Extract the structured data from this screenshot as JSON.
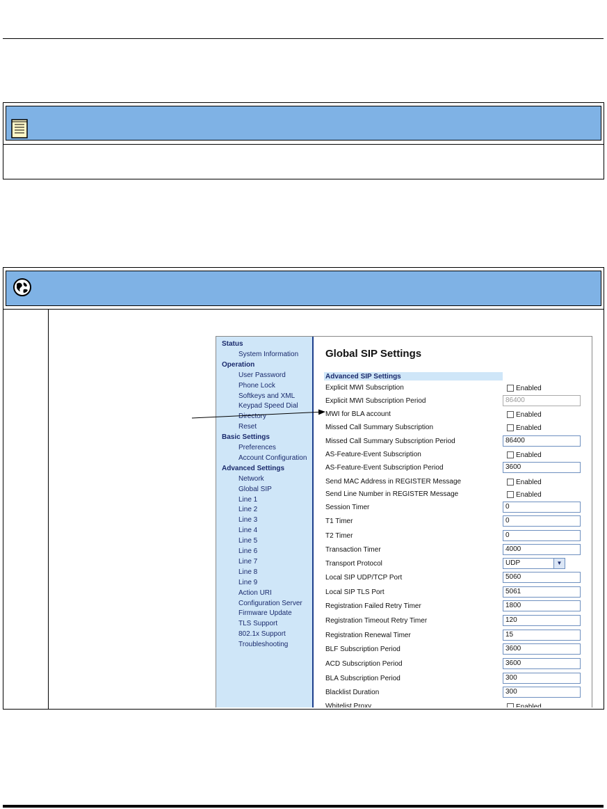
{
  "sidebar": {
    "items": [
      {
        "label": "Status",
        "kind": "head"
      },
      {
        "label": "System Information",
        "kind": "sub"
      },
      {
        "label": "Operation",
        "kind": "head"
      },
      {
        "label": "User Password",
        "kind": "sub"
      },
      {
        "label": "Phone Lock",
        "kind": "sub"
      },
      {
        "label": "Softkeys and XML",
        "kind": "sub"
      },
      {
        "label": "Keypad Speed Dial",
        "kind": "sub"
      },
      {
        "label": "Directory",
        "kind": "sub"
      },
      {
        "label": "Reset",
        "kind": "sub"
      },
      {
        "label": "Basic Settings",
        "kind": "head"
      },
      {
        "label": "Preferences",
        "kind": "sub"
      },
      {
        "label": "Account Configuration",
        "kind": "sub"
      },
      {
        "label": "Advanced Settings",
        "kind": "head"
      },
      {
        "label": "Network",
        "kind": "sub"
      },
      {
        "label": "Global SIP",
        "kind": "sub"
      },
      {
        "label": "Line 1",
        "kind": "sub"
      },
      {
        "label": "Line 2",
        "kind": "sub"
      },
      {
        "label": "Line 3",
        "kind": "sub"
      },
      {
        "label": "Line 4",
        "kind": "sub"
      },
      {
        "label": "Line 5",
        "kind": "sub"
      },
      {
        "label": "Line 6",
        "kind": "sub"
      },
      {
        "label": "Line 7",
        "kind": "sub"
      },
      {
        "label": "Line 8",
        "kind": "sub"
      },
      {
        "label": "Line 9",
        "kind": "sub"
      },
      {
        "label": "Action URI",
        "kind": "sub"
      },
      {
        "label": "Configuration Server",
        "kind": "sub"
      },
      {
        "label": "Firmware Update",
        "kind": "sub"
      },
      {
        "label": "TLS Support",
        "kind": "sub"
      },
      {
        "label": "802.1x Support",
        "kind": "sub"
      },
      {
        "label": "Troubleshooting",
        "kind": "sub"
      }
    ]
  },
  "main": {
    "title": "Global SIP Settings",
    "section": "Advanced SIP Settings",
    "enabled_label": "Enabled",
    "rows": [
      {
        "label": "Explicit MWI Subscription",
        "type": "checkbox"
      },
      {
        "label": "Explicit MWI Subscription Period",
        "type": "text",
        "value": "86400",
        "disabled": true
      },
      {
        "label": "MWI for BLA account",
        "type": "checkbox"
      },
      {
        "label": "Missed Call Summary Subscription",
        "type": "checkbox"
      },
      {
        "label": "Missed Call Summary Subscription Period",
        "type": "text",
        "value": "86400"
      },
      {
        "label": "AS-Feature-Event Subscription",
        "type": "checkbox"
      },
      {
        "label": "AS-Feature-Event Subscription Period",
        "type": "text",
        "value": "3600"
      },
      {
        "label": "Send MAC Address in REGISTER Message",
        "type": "checkbox"
      },
      {
        "label": "Send Line Number in REGISTER Message",
        "type": "checkbox"
      },
      {
        "label": "Session Timer",
        "type": "text",
        "value": "0"
      },
      {
        "label": "T1 Timer",
        "type": "text",
        "value": "0"
      },
      {
        "label": "T2 Timer",
        "type": "text",
        "value": "0"
      },
      {
        "label": "Transaction Timer",
        "type": "text",
        "value": "4000"
      },
      {
        "label": "Transport Protocol",
        "type": "select",
        "value": "UDP"
      },
      {
        "label": "Local SIP UDP/TCP Port",
        "type": "text",
        "value": "5060"
      },
      {
        "label": "Local SIP TLS Port",
        "type": "text",
        "value": "5061"
      },
      {
        "label": "Registration Failed Retry Timer",
        "type": "text",
        "value": "1800"
      },
      {
        "label": "Registration Timeout Retry Timer",
        "type": "text",
        "value": "120"
      },
      {
        "label": "Registration Renewal Timer",
        "type": "text",
        "value": "15"
      },
      {
        "label": "BLF Subscription Period",
        "type": "text",
        "value": "3600"
      },
      {
        "label": "ACD Subscription Period",
        "type": "text",
        "value": "3600"
      },
      {
        "label": "BLA Subscription Period",
        "type": "text",
        "value": "300"
      },
      {
        "label": "Blacklist Duration",
        "type": "text",
        "value": "300"
      },
      {
        "label": "Whitelist Proxy",
        "type": "checkbox"
      }
    ]
  },
  "icons": {
    "note": "note-icon",
    "web_ui": "globe-icon",
    "select_arrow": "chevron-down-icon"
  },
  "colors": {
    "header_blue": "#7fb2e5",
    "sidebar_bg": "#cfe6f8",
    "sidebar_border": "#1c3f8c"
  }
}
